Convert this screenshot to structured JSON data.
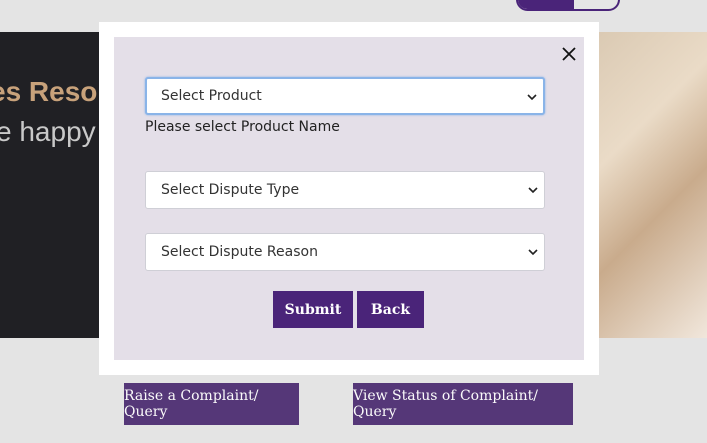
{
  "background": {
    "banner_title": "es Resol",
    "banner_subtitle": "e happy t",
    "raise_button": "Raise a Complaint/ Query",
    "view_button": "View Status of Complaint/ Query"
  },
  "modal": {
    "close_icon": "close-icon",
    "product_select": {
      "value": "Select Product",
      "state": "focused"
    },
    "product_error": "Please select Product Name",
    "dispute_type_select": {
      "value": "Select Dispute Type"
    },
    "dispute_reason_select": {
      "value": "Select Dispute Reason"
    },
    "submit_label": "Submit",
    "back_label": "Back"
  },
  "colors": {
    "brand_purple": "#4a2479",
    "modal_panel": "#e4dfe8",
    "focus_ring": "#8ab4e8"
  }
}
